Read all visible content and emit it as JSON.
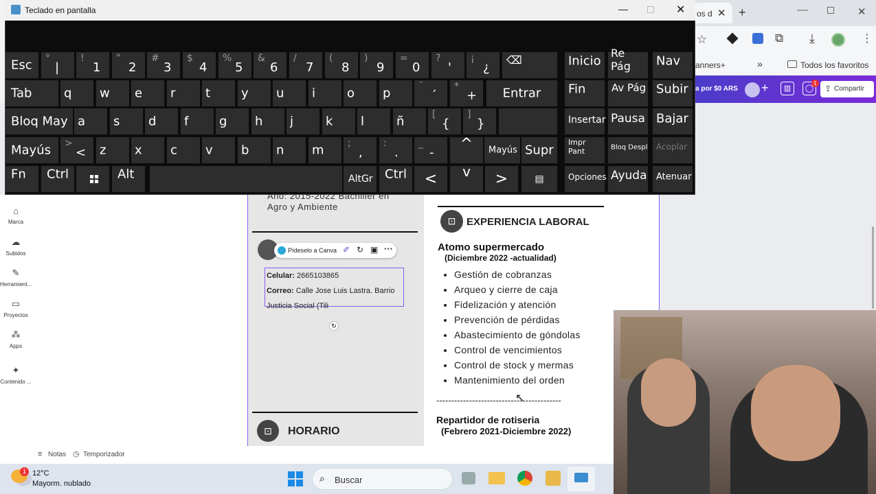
{
  "window": {
    "title": "Teclado en pantalla"
  },
  "browser": {
    "tab_label": "os d",
    "bookmarks": [
      "anners+",
      "Todos los favoritos"
    ],
    "canva_promo": "a por $0 ARS",
    "share_label": "Compartir",
    "notification_count": "1"
  },
  "keyboard": {
    "row1": [
      {
        "shift": "°",
        "main": "|"
      },
      {
        "shift": "!",
        "main": "1"
      },
      {
        "shift": "\"",
        "main": "2"
      },
      {
        "shift": "#",
        "main": "3"
      },
      {
        "shift": "$",
        "main": "4"
      },
      {
        "shift": "%",
        "main": "5"
      },
      {
        "shift": "&",
        "main": "6"
      },
      {
        "shift": "/",
        "main": "7"
      },
      {
        "shift": "(",
        "main": "8"
      },
      {
        "shift": ")",
        "main": "9"
      },
      {
        "shift": "=",
        "main": "0"
      },
      {
        "shift": "?",
        "main": "'"
      },
      {
        "shift": "¡",
        "main": "¿"
      }
    ],
    "esc": "Esc",
    "backspace": "⌫",
    "tab": "Tab",
    "row2": [
      "q",
      "w",
      "e",
      "r",
      "t",
      "y",
      "u",
      "i",
      "o",
      "p"
    ],
    "row2_extra": [
      {
        "shift": "¨",
        "main": "´"
      },
      {
        "shift": "*",
        "main": "+"
      }
    ],
    "enter": "Entrar",
    "caps": "Bloq May",
    "row3": [
      "a",
      "s",
      "d",
      "f",
      "g",
      "h",
      "j",
      "k",
      "l",
      "ñ"
    ],
    "row3_extra": [
      {
        "shift": "[",
        "main": "{"
      },
      {
        "shift": "]",
        "main": "}"
      }
    ],
    "shift": "Mayús",
    "row4": [
      {
        "shift": ">",
        "main": "<"
      },
      {
        "shift": "",
        "main": "z"
      },
      {
        "shift": "",
        "main": "x"
      },
      {
        "shift": "",
        "main": "c"
      },
      {
        "shift": "",
        "main": "v"
      },
      {
        "shift": "",
        "main": "b"
      },
      {
        "shift": "",
        "main": "n"
      },
      {
        "shift": "",
        "main": "m"
      },
      {
        "shift": ";",
        "main": ","
      },
      {
        "shift": ":",
        "main": "."
      },
      {
        "shift": "_",
        "main": "-"
      }
    ],
    "up": "^",
    "shift_right": "Mayús",
    "del": "Supr",
    "fn": "Fn",
    "ctrl": "Ctrl",
    "alt": "Alt",
    "altgr": "AltGr",
    "ctrl_right": "Ctrl",
    "left": "<",
    "down": "v",
    "right": ">",
    "nav": {
      "inicio": "Inicio",
      "repag": "Re Pág",
      "nav": "Nav",
      "fin": "Fin",
      "avpag": "Av Pág",
      "subir": "Subir",
      "insertar": "Insertar",
      "pausa": "Pausa",
      "bajar": "Bajar",
      "imprpant": "Impr Pant",
      "bloqdespl": "Bloq Despl",
      "acoplar": "Acoplar",
      "opciones": "Opciones",
      "ayuda": "Ayuda",
      "atenuar": "Atenuar"
    }
  },
  "canva": {
    "sidebar": [
      "Marca",
      "Subidos",
      "Herramient...",
      "Proyectos",
      "Apps",
      "Contenido ..."
    ],
    "bottom": {
      "notes": "Notas",
      "timer": "Temporizador"
    },
    "ask_canva": "Pídeselo a Canva",
    "doc": {
      "education_line": "Año: 2015-2022 Bachiller en Agro y Ambiente",
      "contact": {
        "phone_label": "Celular:",
        "phone": "2665103865",
        "email_label": "Correo:",
        "email": "Calle Jose Luis Lastra. Barrio Justicia Social (Tili"
      },
      "schedule_heading": "HORARIO",
      "experience_heading": "EXPERIENCIA LABORAL",
      "job1": {
        "title": "Atomo supermercado",
        "period": "(Diciembre 2022 -actualidad)",
        "items": [
          "Gestión de cobranzas",
          "Arqueo y cierre de caja",
          "Fidelización y atención",
          "Prevención de pérdidas",
          "Abastecimiento de góndolas",
          "Control de vencimientos",
          "Control de stock y mermas",
          "Mantenimiento del orden"
        ]
      },
      "divider": "------------------------------------------",
      "job2": {
        "title": "Repartidor de rotiseria",
        "period": "(Febrero 2021-Diciembre 2022)"
      }
    }
  },
  "taskbar": {
    "temp": "12°C",
    "weather": "Mayorm. nublado",
    "search": "Buscar",
    "weather_badge": "1"
  }
}
